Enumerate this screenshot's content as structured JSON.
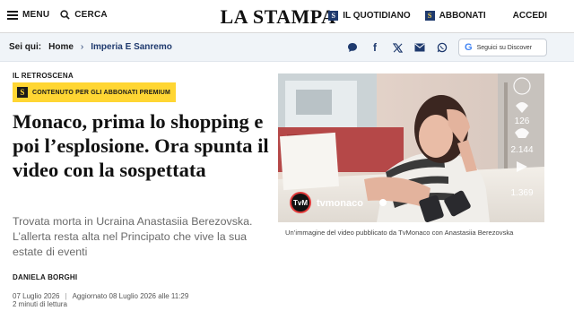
{
  "header": {
    "menu_label": "MENU",
    "search_label": "CERCA",
    "logo": "LA STAMPA",
    "quotidiano_label": "IL QUOTIDIANO",
    "abbonati_label": "ABBONATI",
    "accedi_label": "ACCEDI"
  },
  "breadcrumb": {
    "prefix": "Sei qui:",
    "home": "Home",
    "separator": "›",
    "section": "Imperia E Sanremo"
  },
  "share": {
    "icons": [
      "comment-icon",
      "facebook-icon",
      "x-icon",
      "email-icon",
      "whatsapp-icon"
    ],
    "discover_label": "Seguici su Discover"
  },
  "article": {
    "kicker": "IL RETROSCENA",
    "premium_label": "CONTENUTO PER GLI ABBONATI PREMIUM",
    "headline": "Monaco, prima lo shopping e poi l’esplosione. Ora spunta il video con la sospettata",
    "summary": "Trovata morta in Ucraina Anastasiia Berezovska. L’allerta resta alta nel Principato che vive la sua estate di eventi",
    "author": "DANIELA BORGHI",
    "published": "07 Luglio 2026",
    "updated": "Aggiornato 08 Luglio 2026 alle 11:29",
    "reading_time": "2 minuti di lettura"
  },
  "image": {
    "channel": "tvmonaco",
    "caption": "Un’immagine del video pubblicato da TvMonaco con Anastasiia Berezovska",
    "likes": "126",
    "comments": "2.144",
    "shares": "1.369"
  },
  "colors": {
    "brand_blue": "#1f3a6e",
    "premium_yellow": "#ffd633",
    "crumb_bg": "#f0f4f8"
  }
}
